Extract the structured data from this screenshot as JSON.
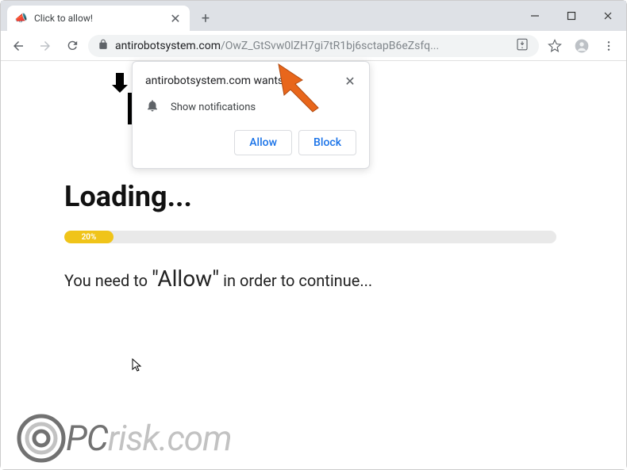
{
  "tab": {
    "title": "Click to allow!"
  },
  "url": {
    "domain": "antirobotsystem.com",
    "path": "/OwZ_GtSvw0lZH7gi7tR1bj6sctapB6eZsfq..."
  },
  "permission": {
    "origin_wants": "antirobotsystem.com wants to",
    "capability": "Show notifications",
    "allow": "Allow",
    "block": "Block"
  },
  "page": {
    "loading": "Loading...",
    "progress_pct": "20%",
    "instruction_pre": "You need to ",
    "instruction_quoted": "\"Allow\"",
    "instruction_post": " in order to continue..."
  },
  "watermark": {
    "p": "P",
    "c": "C",
    "rest": "risk.com"
  },
  "icons": {
    "favicon": "📣",
    "close_x": "✕",
    "plus": "+"
  }
}
